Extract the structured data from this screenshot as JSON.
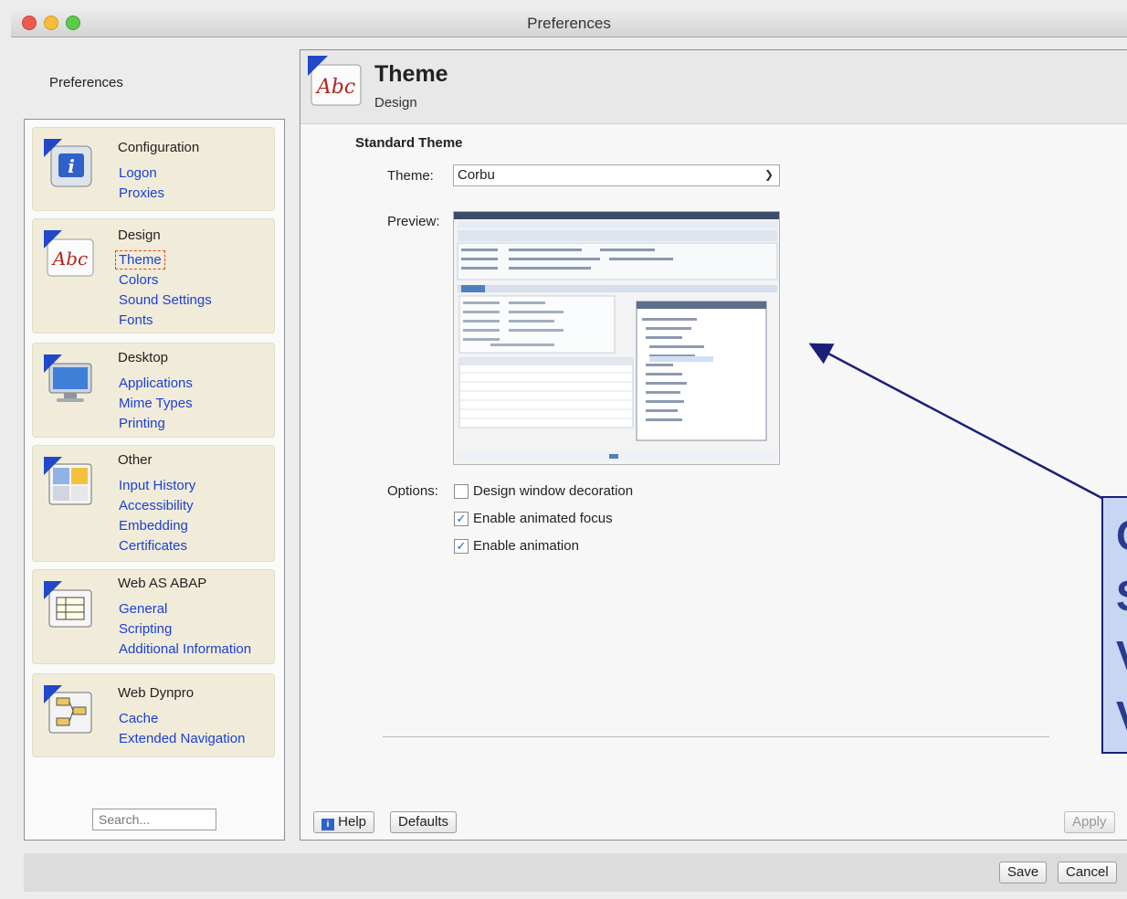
{
  "window": {
    "title": "Preferences"
  },
  "sidebar": {
    "title": "Preferences",
    "groups": [
      {
        "title": "Configuration",
        "icon": "info-icon",
        "links": [
          "Logon",
          "Proxies"
        ]
      },
      {
        "title": "Design",
        "icon": "abc-icon",
        "links": [
          "Theme",
          "Colors",
          "Sound Settings",
          "Fonts"
        ]
      },
      {
        "title": "Desktop",
        "icon": "monitor-icon",
        "links": [
          "Applications",
          "Mime Types",
          "Printing"
        ]
      },
      {
        "title": "Other",
        "icon": "window-grid-icon",
        "links": [
          "Input History",
          "Accessibility",
          "Embedding",
          "Certificates"
        ]
      },
      {
        "title": "Web AS ABAP",
        "icon": "form-icon",
        "links": [
          "General",
          "Scripting",
          "Additional Information"
        ]
      },
      {
        "title": "Web Dynpro",
        "icon": "network-icon",
        "links": [
          "Cache",
          "Extended Navigation"
        ]
      }
    ],
    "selected": "Theme",
    "search_placeholder": "Search..."
  },
  "panel": {
    "title": "Theme",
    "subtitle": "Design",
    "section_title": "Standard Theme",
    "theme_label": "Theme:",
    "theme_value": "Corbu",
    "preview_label": "Preview:",
    "options_label": "Options:",
    "options": [
      {
        "label": "Design window decoration",
        "checked": false
      },
      {
        "label": "Enable animated focus",
        "checked": true
      },
      {
        "label": "Enable animation",
        "checked": true
      }
    ]
  },
  "buttons": {
    "help": "Help",
    "defaults": "Defaults",
    "apply": "Apply",
    "save": "Save",
    "cancel": "Cancel"
  },
  "callout": {
    "lines": [
      "C",
      "S",
      "V",
      "V"
    ]
  },
  "colors": {
    "link": "#1a3fd6",
    "group_bg": "#f1ecd9",
    "callout_bg": "#c7d6f3",
    "callout_border": "#1a1f7a",
    "arrow": "#1a1f7a"
  }
}
